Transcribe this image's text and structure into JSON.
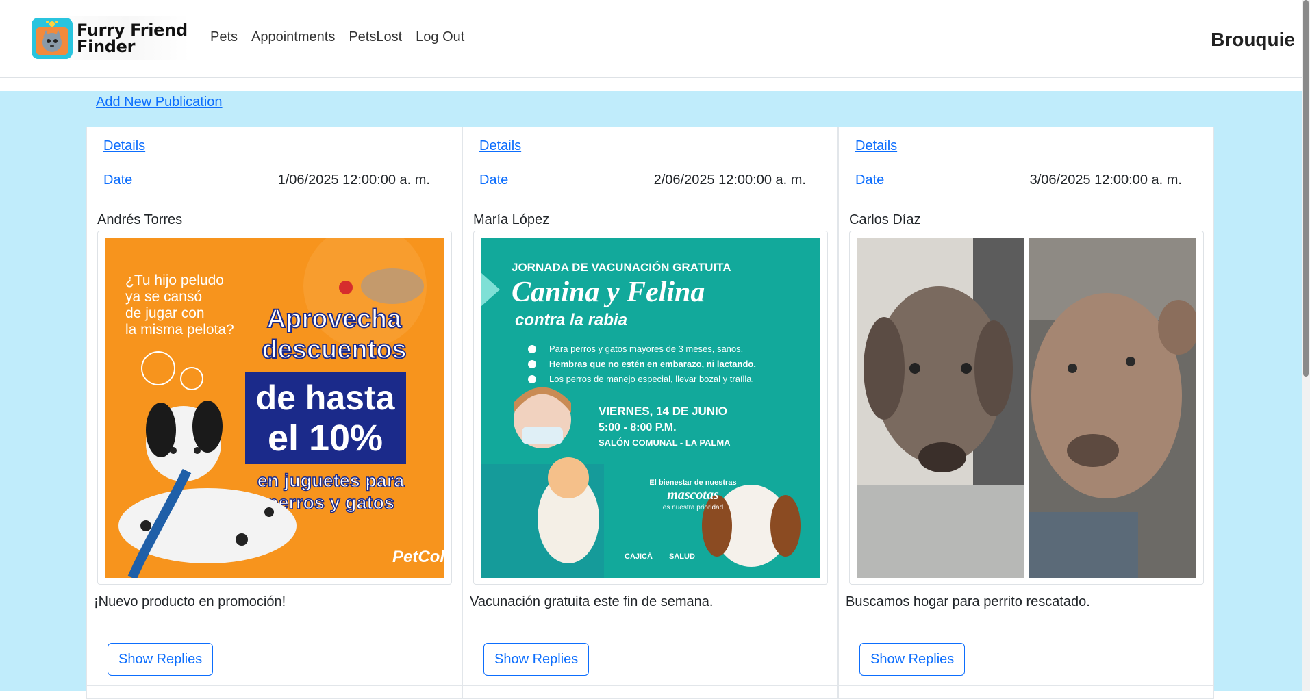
{
  "brand": {
    "name_line1": "Furry Friend",
    "name_line2": "Finder",
    "logo": "pet-logo-icon"
  },
  "nav": [
    "Pets",
    "Appointments",
    "PetsLost",
    "Log Out"
  ],
  "user": {
    "name": "Brouquie"
  },
  "main": {
    "add_link": "Add New Publication"
  },
  "cards": [
    {
      "details": "Details",
      "date_label": "Date",
      "date": "1/06/2025 12:00:00 a. m.",
      "author": "Andrés Torres",
      "description": "¡Nuevo producto en promoción!",
      "button": "Show Replies",
      "image": {
        "kind": "promo-banner",
        "lines": [
          "¿Tu hijo peludo",
          "ya se cansó",
          "de jugar con",
          "la misma pelota?"
        ],
        "headline": [
          "Aprovecha",
          "descuentos"
        ],
        "highlight": [
          "de hasta",
          "el 10%"
        ],
        "subline": [
          "en juguetes para",
          "perros y gatos"
        ],
        "brand": "PetCol",
        "colors": {
          "bg": "#f7941d",
          "blue": "#1b2a8a"
        }
      }
    },
    {
      "details": "Details",
      "date_label": "Date",
      "date": "2/06/2025 12:00:00 a. m.",
      "author": "María López",
      "description": "Vacunación gratuita este fin de semana.",
      "button": "Show Replies",
      "image": {
        "kind": "vaccination-poster",
        "top": "JORNADA DE VACUNACIÓN GRATUITA",
        "title": "Canina y Felina",
        "subtitle": "contra la rabia",
        "bullets": [
          "Para perros y gatos mayores de 3 meses, sanos.",
          "Hembras que no estén en embarazo, ni lactando.",
          "Los perros de manejo especial, llevar bozal y traílla."
        ],
        "when": "VIERNES, 14 DE JUNIO",
        "time": "5:00 - 8:00 P.M.",
        "where": "SALÓN COMUNAL - LA PALMA",
        "footer1": "El bienestar de nuestras",
        "footer2": "mascotas",
        "footer3": "es nuestra prioridad",
        "logo1": "CAJICÁ",
        "logo2": "SALUD",
        "colors": {
          "bg": "#12a99b"
        }
      }
    },
    {
      "details": "Details",
      "date_label": "Date",
      "date": "3/06/2025 12:00:00 a. m.",
      "author": "Carlos Díaz",
      "description": "Buscamos hogar para perrito rescatado.",
      "button": "Show Replies",
      "image": {
        "kind": "dog-photo-collage",
        "colors": {
          "dog": "#a58672",
          "bg": "#4a4a4a"
        }
      }
    }
  ]
}
